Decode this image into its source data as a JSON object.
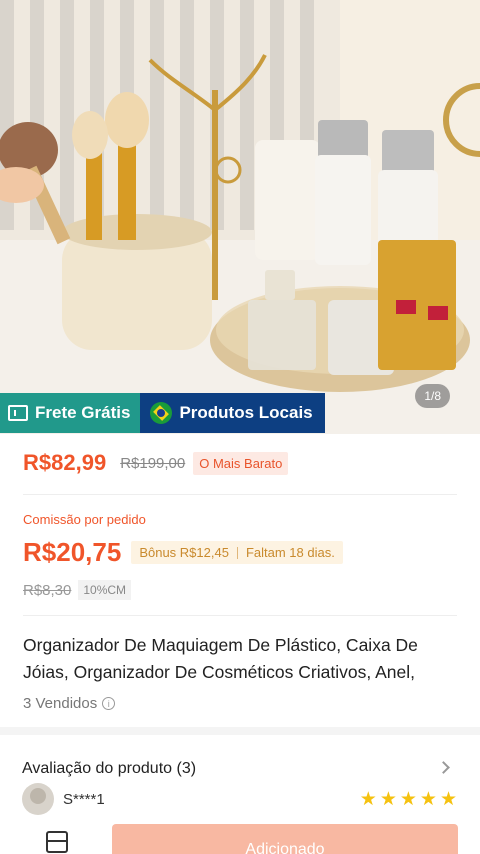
{
  "hero": {
    "badge_frete": "Frete Grátis",
    "badge_locais": "Produtos Locais",
    "pager": "1/8"
  },
  "pricing": {
    "price": "R$82,99",
    "old_price": "R$199,00",
    "cheapest_tag": "O Mais Barato"
  },
  "commission": {
    "label": "Comissão por pedido",
    "value": "R$20,75",
    "bonus": "Bônus R$12,45",
    "remaining": "Faltam 18 dias.",
    "original": "R$8,30",
    "cm_tag": "10%CM"
  },
  "product": {
    "title": "Organizador De Maquiagem De Plástico, Caixa De Jóias, Organizador De Cosméticos Criativos, Anel,",
    "sold": "3 Vendidos",
    "info_glyph": "i"
  },
  "reviews": {
    "title": "Avaliação do produto (3)",
    "reviewer": "S****1",
    "rating": 5,
    "star_glyph": "★"
  },
  "bottom": {
    "add_label": "Adicionado"
  },
  "colors": {
    "accent": "#f0552a",
    "frete_bg": "#21998b",
    "locais_bg": "#0d3f82",
    "star": "#f5c210",
    "add_button": "#f8b8a2"
  },
  "icons": {
    "frete": "truck-ticket-icon",
    "locais": "brazil-flag-icon",
    "info": "info-icon",
    "chevron": "chevron-right-icon",
    "store": "store-icon"
  }
}
